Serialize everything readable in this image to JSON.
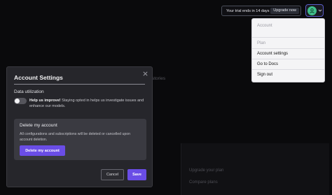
{
  "topbar": {
    "trial_text": "Your trial ends in 14 days",
    "upgrade_label": "Upgrade now"
  },
  "account_menu": {
    "header": "Account",
    "plan": "Plan",
    "settings": "Account settings",
    "docs": "Go to Docs",
    "signout": "Sign out"
  },
  "background": {
    "fragment": "stories",
    "card_items": [
      "Upgrade your plan",
      "Compare plans"
    ]
  },
  "modal": {
    "title": "Account Settings",
    "data_section_label": "Data utilization",
    "help_bold": "Help us improve!",
    "help_text": " Staying opted in helps us investigate issues and enhance our models.",
    "toggle_on": false,
    "delete_title": "Delete my account",
    "delete_text": "All configurations and subscriptions will be deleted or cancelled upon account deletion.",
    "delete_button": "Delete my account",
    "cancel_label": "Cancel",
    "save_label": "Save"
  },
  "colors": {
    "accent": "#6a4de6",
    "avatar": "#3fbf8a"
  }
}
